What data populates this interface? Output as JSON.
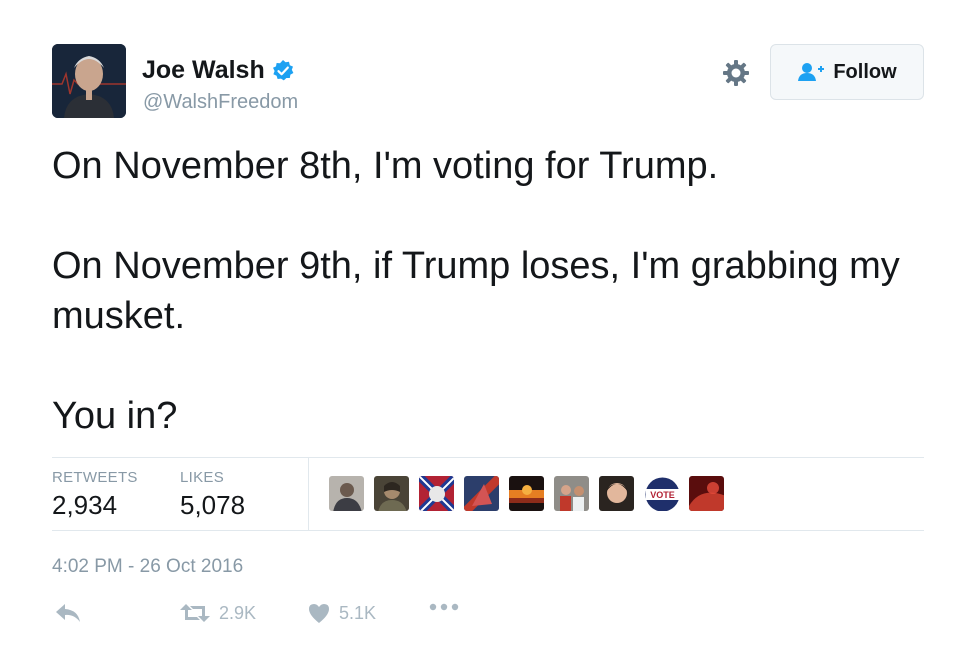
{
  "user": {
    "name": "Joe Walsh",
    "handle": "@WalshFreedom"
  },
  "follow_label": "Follow",
  "tweet": {
    "paragraphs": [
      "On November 8th, I'm voting for Trump.",
      "On November 9th, if Trump loses, I'm grabbing my musket.",
      "You in?"
    ]
  },
  "stats": {
    "retweets_label": "RETWEETS",
    "retweets_value": "2,934",
    "likes_label": "LIKES",
    "likes_value": "5,078"
  },
  "timestamp": "4:02 PM - 26 Oct 2016",
  "actions": {
    "retweet_count": "2.9K",
    "like_count": "5.1K"
  },
  "liker_badge": "VOTE",
  "colors": {
    "verified": "#1da1f2",
    "follow_icon": "#1da1f2",
    "muted": "#8899a6",
    "icon_gray": "#aab8c2"
  }
}
